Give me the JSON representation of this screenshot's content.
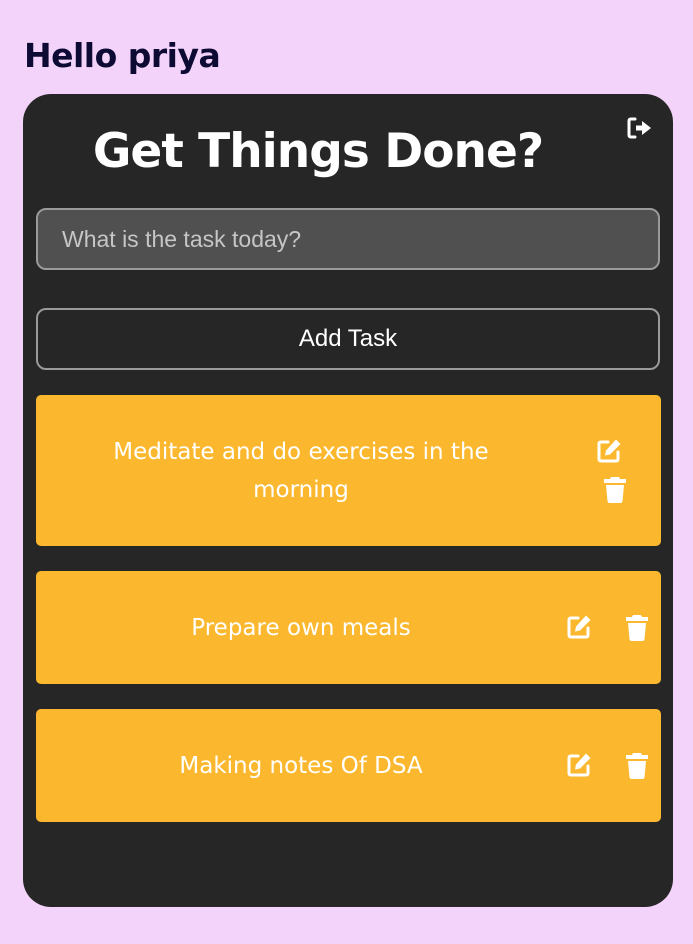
{
  "greeting": "Hello priya",
  "card": {
    "title": "Get Things Done?"
  },
  "input": {
    "placeholder": "What is the task today?",
    "value": ""
  },
  "add_button": "Add Task",
  "tasks": [
    {
      "text": "Meditate and do exercises in the morning"
    },
    {
      "text": "Prepare own meals"
    },
    {
      "text": "Making notes Of DSA"
    }
  ],
  "icons": {
    "logout": "logout-icon",
    "edit": "edit-icon",
    "delete": "trash-icon"
  },
  "colors": {
    "background": "#f3d3fa",
    "card": "#262626",
    "task": "#fbb82e",
    "greeting": "#0d0a33"
  }
}
